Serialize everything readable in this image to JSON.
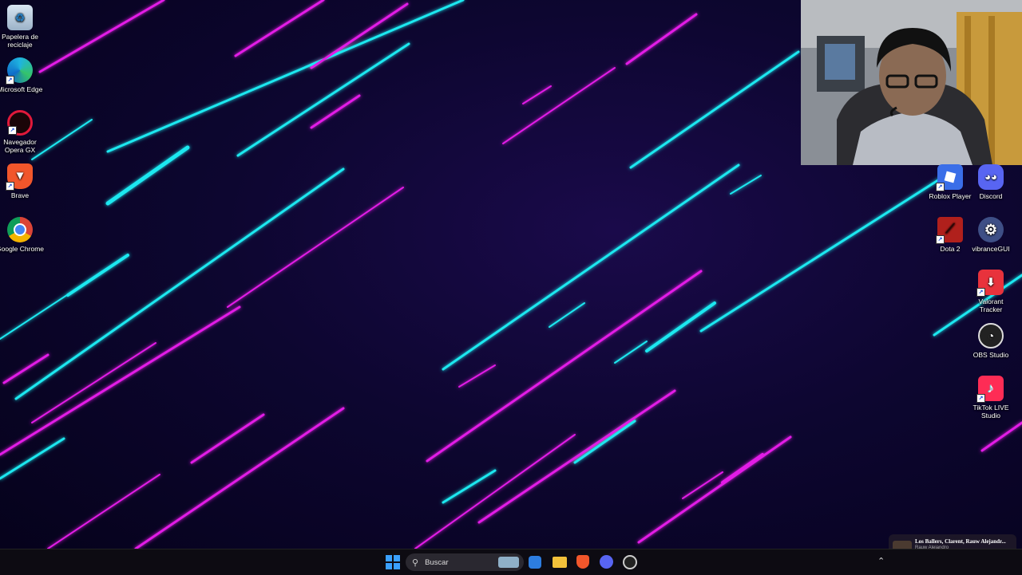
{
  "desktop": {
    "left_icons": [
      {
        "label": "Papelera de reciclaje",
        "icon": "recycle-bin-icon"
      },
      {
        "label": "Microsoft Edge",
        "icon": "edge-icon"
      },
      {
        "label": "Navegador Opera GX",
        "icon": "opera-gx-icon"
      },
      {
        "label": "Brave",
        "icon": "brave-icon"
      },
      {
        "label": "Google Chrome",
        "icon": "chrome-icon"
      }
    ],
    "right_icons": [
      {
        "label": "Roblox Player",
        "icon": "roblox-icon"
      },
      {
        "label": "Discord",
        "icon": "discord-icon"
      },
      {
        "label": "Dota 2",
        "icon": "dota2-icon"
      },
      {
        "label": "vibranceGUI",
        "icon": "gear-icon"
      },
      {
        "label": "Valorant Tracker",
        "icon": "valorant-tracker-icon"
      },
      {
        "label": "OBS Studio",
        "icon": "obs-icon"
      },
      {
        "label": "TikTok LIVE Studio",
        "icon": "tiktok-icon"
      }
    ]
  },
  "taskbar": {
    "search_placeholder": "Buscar",
    "apps": [
      "windows-start-icon",
      "search-icon",
      "store-icon",
      "file-explorer-icon",
      "brave-icon",
      "discord-icon",
      "obs-icon"
    ]
  },
  "media": {
    "title": "Los Ballers, Clarent, Rauw Alejandr...",
    "artist": "Rauw Alejandro"
  },
  "colors": {
    "cyan": "#1fe8f0",
    "magenta": "#e21be6",
    "taskbar": "#0d0b12"
  }
}
